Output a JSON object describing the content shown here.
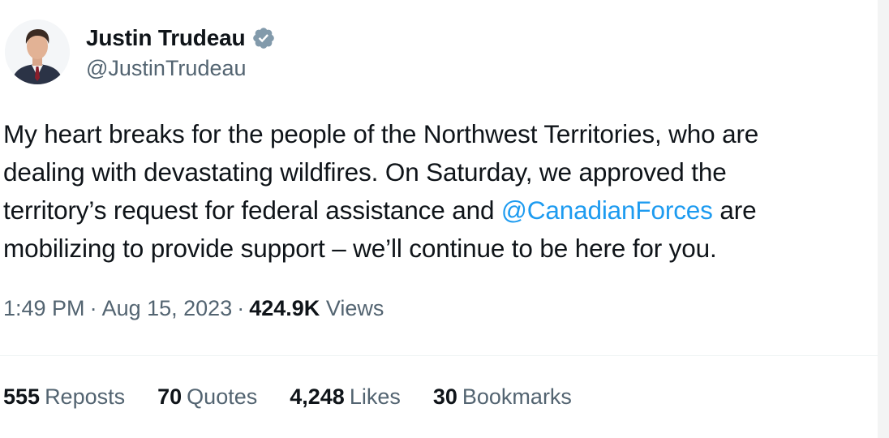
{
  "author": {
    "name": "Justin Trudeau",
    "handle": "@JustinTrudeau",
    "verified_icon": "verified-badge-icon"
  },
  "tweet": {
    "line1": "My heart breaks for the people of the Northwest Territories, who are",
    "line2": "dealing with devastating wildfires. On Saturday, we approved the",
    "line3_before": "territory’s request for federal assistance and ",
    "mention": "@CanadianForces",
    "line3_after": " are",
    "line4": "mobilizing to provide support – we’ll continue to be here for you."
  },
  "meta": {
    "time": "1:49 PM",
    "separator": "·",
    "date": "Aug 15, 2023",
    "views_count": "424.9K",
    "views_label": "Views"
  },
  "stats": {
    "reposts_count": "555",
    "reposts_label": "Reposts",
    "quotes_count": "70",
    "quotes_label": "Quotes",
    "likes_count": "4,248",
    "likes_label": "Likes",
    "bookmarks_count": "30",
    "bookmarks_label": "Bookmarks"
  },
  "colors": {
    "text": "#0f1419",
    "secondary": "#536471",
    "link": "#1d9bf0",
    "divider": "#eff3f4"
  }
}
